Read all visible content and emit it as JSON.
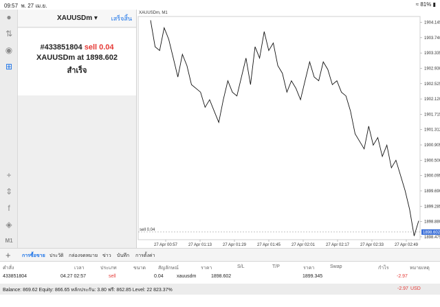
{
  "status": {
    "time": "09:57",
    "date": "พ. 27 เม.ย.",
    "wifi": "wifi-icon",
    "battery": "81%"
  },
  "panel": {
    "symbol": "XAUUSDm",
    "done_label": "เสร็จสิ้น",
    "result_ticket": "#433851804",
    "result_side": "sell 0.04",
    "result_text": "XAUUSDm at",
    "result_price": "1898.602",
    "result_status": "สำเร็จ"
  },
  "chart_data": {
    "type": "line",
    "title": "XAUUSDm, M1",
    "x": [
      "27 Apr 00:57",
      "27 Apr 01:13",
      "27 Apr 01:29",
      "27 Apr 01:45",
      "27 Apr 02:01",
      "27 Apr 02:17",
      "27 Apr 02:33",
      "27 Apr 02:49"
    ],
    "y_ticks": [
      "1904.145",
      "1903.740",
      "1903.335",
      "1902.930",
      "1902.525",
      "1902.120",
      "1901.715",
      "1901.312",
      "1900.905",
      "1900.500",
      "1900.095",
      "1899.690",
      "1899.285",
      "1898.880",
      "1898.475"
    ],
    "ylim": [
      1898.4,
      1904.3
    ],
    "series": [
      {
        "values": [
          1904.2,
          1903.5,
          1903.4,
          1904.0,
          1903.7,
          1903.2,
          1902.7,
          1903.3,
          1903.0,
          1902.5,
          1902.4,
          1902.3,
          1901.9,
          1902.1,
          1901.8,
          1901.5,
          1902.1,
          1902.6,
          1902.3,
          1902.2,
          1902.7,
          1903.2,
          1902.5,
          1903.5,
          1903.2,
          1903.9,
          1903.4,
          1903.6,
          1903.0,
          1902.8,
          1902.3,
          1902.6,
          1902.4,
          1902.1,
          1902.6,
          1903.1,
          1902.7,
          1902.6,
          1903.1,
          1902.9,
          1902.5,
          1902.6,
          1902.3,
          1902.2,
          1901.8,
          1901.2,
          1901.0,
          1900.8,
          1901.4,
          1900.9,
          1901.1,
          1900.6,
          1900.9,
          1900.3,
          1900.5,
          1900.1,
          1899.7,
          1899.2,
          1898.5,
          1898.9
        ]
      }
    ],
    "position_line": {
      "label": "sell 0.04",
      "value": 1898.602
    },
    "current_price": "1898.602"
  },
  "tabs": [
    "การซื้อขาย",
    "ประวัติ",
    "กล่องจดหมาย",
    "ข่าว",
    "บันทึก",
    "การตั้งค่า"
  ],
  "table": {
    "headers": [
      "คำสั่ง",
      "เวลา",
      "ประเภท",
      "ขนาด",
      "สัญลักษณ์",
      "ราคา",
      "S/L",
      "T/P",
      "ราคา",
      "Swap",
      "กำไร",
      "หมายเหตุ"
    ],
    "row": [
      "433851804",
      "04.27 02:57",
      "sell",
      "0.04",
      "xauusdm",
      "1898.602",
      "",
      "",
      "1899.345",
      "",
      "-2.97",
      ""
    ]
  },
  "balance": {
    "text": "Balance: 869.62 Equity: 866.65 หลักประกัน: 3.80 ฟรี: 862.85 Level: 22 823.37%",
    "profit": "-2.97",
    "currency": "USD"
  },
  "colors": {
    "accent": "#1b73e8",
    "sell": "#e53935"
  }
}
